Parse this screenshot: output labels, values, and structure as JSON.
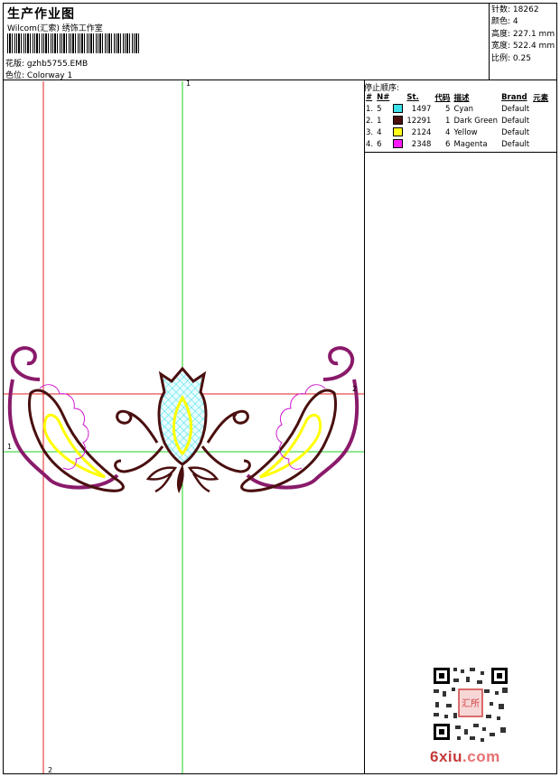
{
  "header": {
    "title": "生产作业图",
    "company": "Wilcom(汇索) 绣饰工作室",
    "design_label": "花版:",
    "design_value": "gzhb5755.EMB",
    "colorway_label": "色位:",
    "colorway_value": "Colorway 1"
  },
  "stats": {
    "stitches_label": "针数:",
    "stitches_value": "18262",
    "colors_label": "颜色:",
    "colors_value": "4",
    "height_label": "高度:",
    "height_value": "227.1 mm",
    "width_label": "宽度:",
    "width_value": "522.4 mm",
    "scale_label": "比例:",
    "scale_value": "0.25"
  },
  "sequence": {
    "title": "停止顺序:",
    "headers": [
      "#",
      "N#",
      "St.",
      "代码",
      "描述",
      "Brand",
      "元素"
    ],
    "rows": [
      {
        "idx": "1.",
        "n": "5",
        "color": "#3de0e8",
        "st": "1497",
        "code": "5",
        "desc": "Cyan",
        "brand": "Default"
      },
      {
        "idx": "2.",
        "n": "1",
        "color": "#4a0f0f",
        "st": "12291",
        "code": "1",
        "desc": "Dark Green",
        "brand": "Default"
      },
      {
        "idx": "3.",
        "n": "4",
        "color": "#ffff1a",
        "st": "2124",
        "code": "4",
        "desc": "Yellow",
        "brand": "Default"
      },
      {
        "idx": "4.",
        "n": "6",
        "color": "#ff1aff",
        "st": "2348",
        "code": "6",
        "desc": "Magenta",
        "brand": "Default"
      }
    ]
  },
  "canvas": {
    "axis_labels": {
      "h1": "1",
      "h2": "2",
      "v1": "1",
      "v2": "2"
    }
  },
  "watermark": {
    "site_prefix": "6xiu",
    "site_suffix": ".com",
    "seal_text": "汇所"
  }
}
